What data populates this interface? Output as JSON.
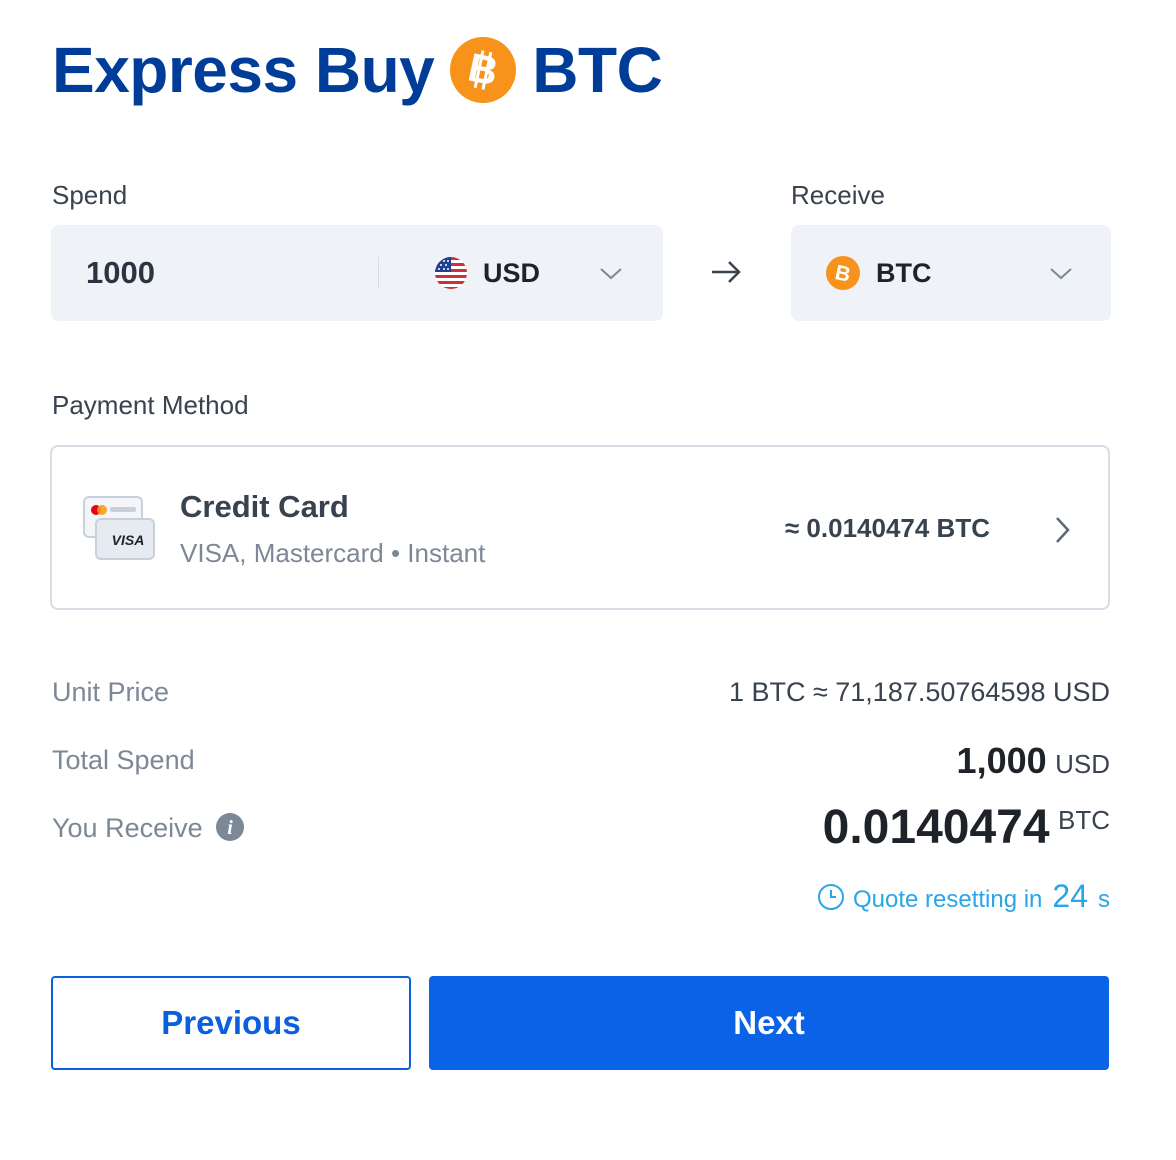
{
  "header": {
    "title_prefix": "Express Buy",
    "title_asset": "BTC",
    "asset_icon": "bitcoin-icon"
  },
  "spend": {
    "label": "Spend",
    "amount": "1000",
    "currency": "USD",
    "currency_icon": "us-flag-icon"
  },
  "receive": {
    "label": "Receive",
    "currency": "BTC",
    "currency_icon": "bitcoin-icon"
  },
  "payment": {
    "label": "Payment Method",
    "method_name": "Credit Card",
    "method_sub": "VISA, Mastercard • Instant",
    "approx_amount": "≈ 0.0140474 BTC",
    "card_brand_text": "VISA"
  },
  "summary": {
    "unit_price_label": "Unit Price",
    "unit_price_value": "1 BTC ≈ 71,187.50764598 USD",
    "total_spend_label": "Total Spend",
    "total_spend_amount": "1,000",
    "total_spend_unit": "USD",
    "receive_label": "You Receive",
    "receive_amount": "0.0140474",
    "receive_unit": "BTC"
  },
  "quote": {
    "text": "Quote resetting in",
    "seconds": "24",
    "unit": "s"
  },
  "actions": {
    "previous_label": "Previous",
    "next_label": "Next"
  },
  "colors": {
    "brand_blue": "#003d99",
    "primary_button": "#0a63e6",
    "bitcoin_orange": "#f7931a",
    "quote_blue": "#29a6e8",
    "input_bg": "#eff2f6"
  }
}
